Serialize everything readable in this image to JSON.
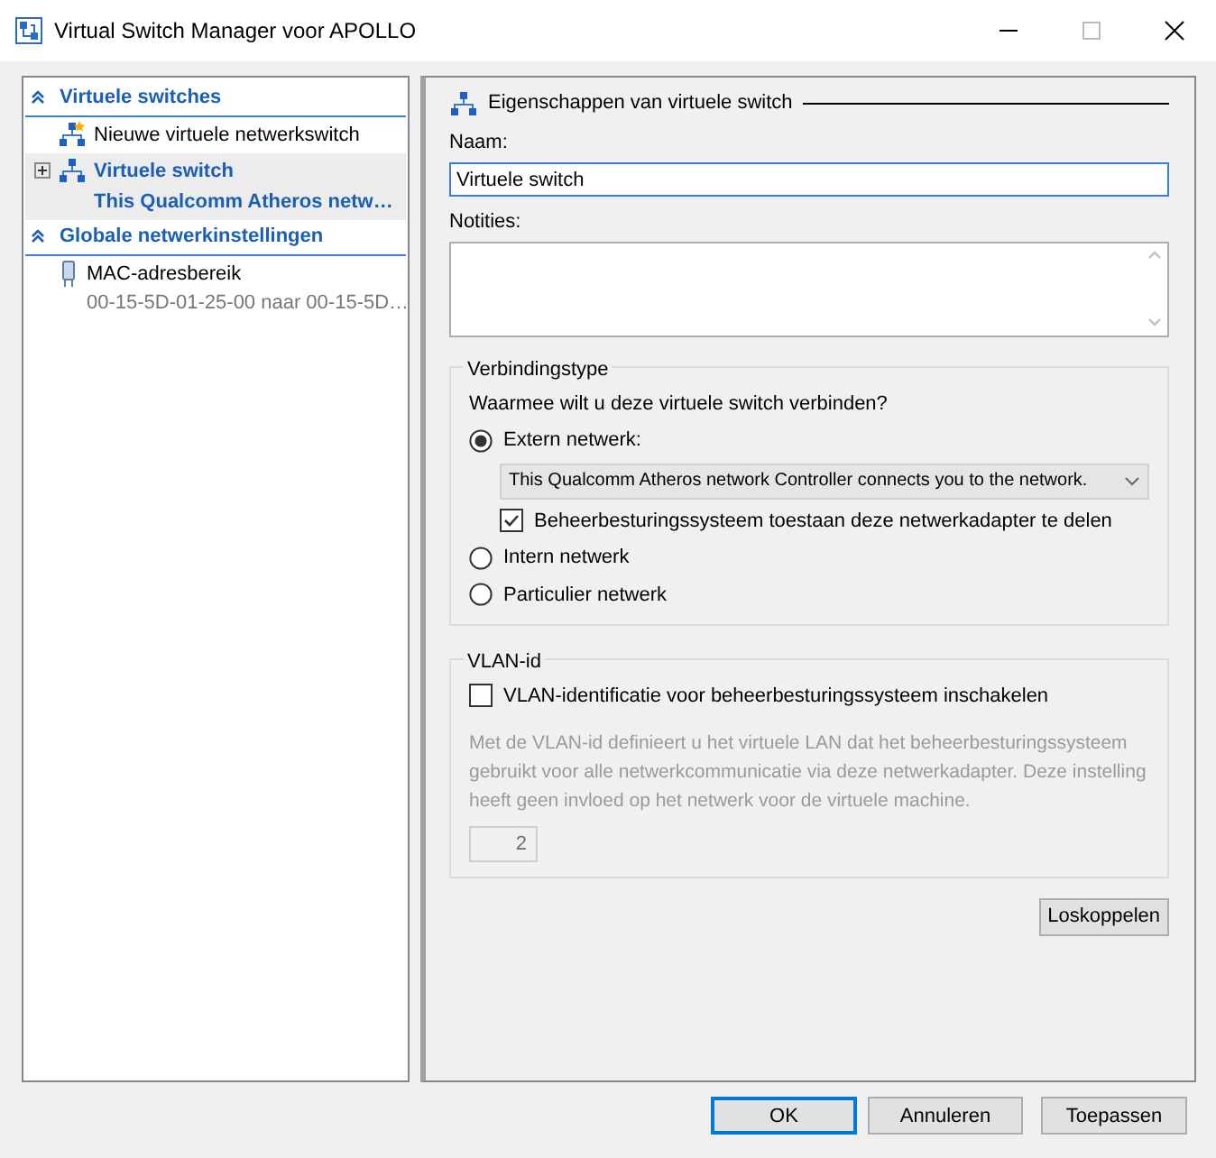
{
  "window": {
    "title": "Virtual Switch Manager voor APOLLO"
  },
  "sidebar": {
    "sections": [
      {
        "title": "Virtuele switches",
        "expanded": true,
        "items": [
          {
            "kind": "new-switch",
            "label": "Nieuwe virtuele netwerkswitch",
            "selected": false
          },
          {
            "kind": "switch",
            "label": "Virtuele switch",
            "sublabel": "This Qualcomm Atheros netw…",
            "selected": true,
            "expander": {
              "expanded": false
            }
          }
        ]
      },
      {
        "title": "Globale netwerkinstellingen",
        "expanded": true,
        "items": [
          {
            "kind": "mac-range",
            "label": "MAC-adresbereik",
            "sublabel": "00-15-5D-01-25-00 naar 00-15-5D…",
            "selected": false
          }
        ]
      }
    ]
  },
  "properties": {
    "heading": "Eigenschappen van virtuele switch",
    "name_label": "Naam:",
    "name_value": "Virtuele switch",
    "notes_label": "Notities:",
    "connection": {
      "legend": "Verbindingstype",
      "question": "Waarmee wilt u deze virtuele switch verbinden?",
      "options": [
        {
          "label": "Extern netwerk:",
          "selected": true,
          "adapter": "This Qualcomm Atheros network Controller connects you to the network.",
          "share": {
            "label": "Beheerbesturingssysteem toestaan deze netwerkadapter te delen",
            "checked": true
          }
        },
        {
          "label": "Intern netwerk",
          "selected": false
        },
        {
          "label": "Particulier netwerk",
          "selected": false
        }
      ]
    },
    "vlan": {
      "legend": "VLAN-id",
      "checkbox": {
        "label": "VLAN-identificatie voor beheerbesturingssysteem inschakelen",
        "checked": false
      },
      "description": "Met de VLAN-id definieert u het virtuele LAN dat het beheerbesturingssysteem gebruikt voor alle netwerkcommunicatie via deze netwerkadapter. Deze instelling heeft geen invloed op het netwerk voor de virtuele machine.",
      "id_value": "2",
      "disabled": true
    },
    "remove_button": "Loskoppelen"
  },
  "buttons": [
    {
      "label": "OK",
      "default": true
    },
    {
      "label": "Annuleren",
      "default": false
    },
    {
      "label": "Toepassen",
      "default": false
    }
  ]
}
